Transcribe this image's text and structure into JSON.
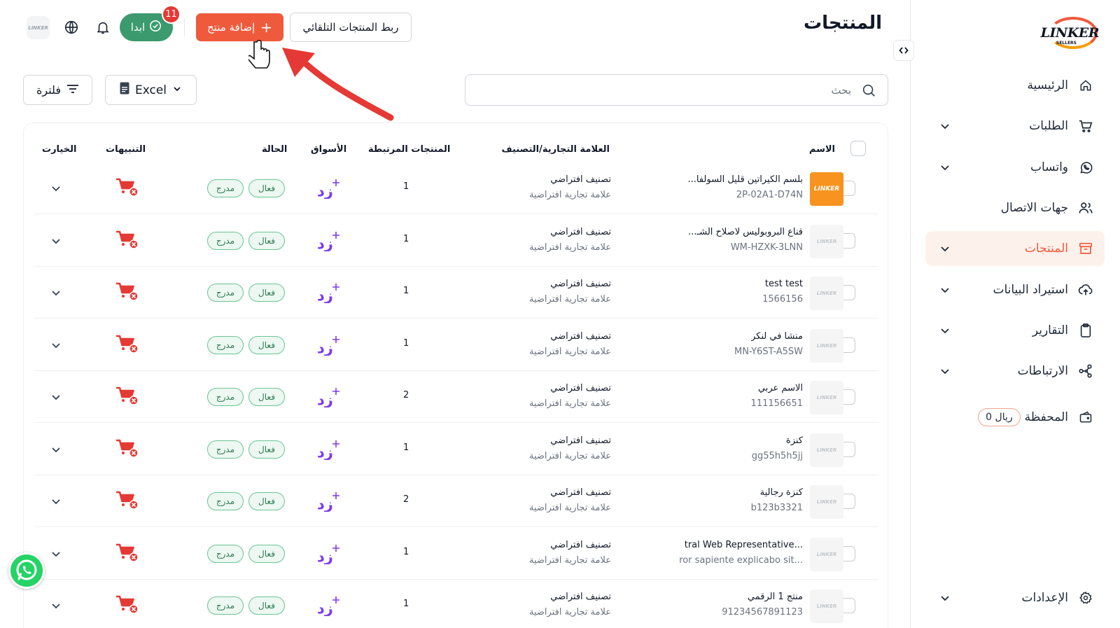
{
  "app": {
    "logo_text": "LINKER",
    "logo_sub": "SELLERS",
    "page_title": "المنتجات"
  },
  "sidebar": {
    "items": [
      {
        "label": "الرئيسية",
        "icon": "home-icon",
        "chevron": false,
        "active": false
      },
      {
        "label": "الطلبات",
        "icon": "cart-icon",
        "chevron": true,
        "active": false
      },
      {
        "label": "واتساب",
        "icon": "whatsapp-icon",
        "chevron": true,
        "active": false
      },
      {
        "label": "جهات الاتصال",
        "icon": "users-icon",
        "chevron": false,
        "active": false
      },
      {
        "label": "المنتجات",
        "icon": "box-icon",
        "chevron": true,
        "active": true
      },
      {
        "label": "استيراد البيانات",
        "icon": "upload-icon",
        "chevron": true,
        "active": false
      },
      {
        "label": "التقارير",
        "icon": "clipboard-icon",
        "chevron": true,
        "active": false
      },
      {
        "label": "الارتباطات",
        "icon": "share-icon",
        "chevron": true,
        "active": false
      }
    ],
    "wallet": {
      "label": "المحفظة",
      "balance": "0 ريال"
    },
    "settings": {
      "label": "الإعدادات"
    }
  },
  "toolbar": {
    "sync_label": "ربط المنتجات التلقائي",
    "add_label": "إضافة منتج",
    "start_label": "ابدا",
    "start_badge": "11",
    "avatar_text": "LINKER"
  },
  "search": {
    "placeholder": "بحث"
  },
  "filters": {
    "excel_label": "Excel",
    "filter_label": "فلترة"
  },
  "table": {
    "headers": {
      "name": "الاسم",
      "brand": "العلامة التجارية/التصنيف",
      "linked": "المنتجات المرتبطة",
      "markets": "الأسواق",
      "status": "الحالة",
      "alerts": "التنبيهات",
      "options": "الخيارت"
    },
    "status_active": "فعال",
    "status_listed": "مدرج",
    "market_logo": "زد",
    "rows": [
      {
        "name": "بلسم الكيراتين قليل السولفا...",
        "sku": "2P-02A1-D74N",
        "category": "تصنيف افتراضي",
        "brand": "علامة تجارية افتراضية",
        "linked": "1",
        "thumb": "orange"
      },
      {
        "name": "قناع البروبوليس لاصلاح الشـ...",
        "sku": "WM-HZXK-3LNN",
        "category": "تصنيف افتراضي",
        "brand": "علامة تجارية افتراضية",
        "linked": "1",
        "thumb": "gray"
      },
      {
        "name": "test test",
        "sku": "1566156",
        "category": "تصنيف افتراضي",
        "brand": "علامة تجارية افتراضية",
        "linked": "1",
        "thumb": "gray"
      },
      {
        "name": "منشأ في لنكر",
        "sku": "MN-Y6ST-A5SW",
        "category": "تصنيف افتراضي",
        "brand": "علامة تجارية افتراضية",
        "linked": "1",
        "thumb": "gray"
      },
      {
        "name": "الاسم عربي",
        "sku": "111156651",
        "category": "تصنيف افتراضي",
        "brand": "علامة تجارية افتراضية",
        "linked": "2",
        "thumb": "gray"
      },
      {
        "name": "كنزة",
        "sku": "gg55h5h5jj",
        "category": "تصنيف افتراضي",
        "brand": "علامة تجارية افتراضية",
        "linked": "1",
        "thumb": "gray"
      },
      {
        "name": "كنزة رجالية",
        "sku": "b123b3321",
        "category": "تصنيف افتراضي",
        "brand": "علامة تجارية افتراضية",
        "linked": "2",
        "thumb": "gray"
      },
      {
        "name": "...tral Web Representative",
        "sku": "...ror sapiente explicabo sit",
        "category": "تصنيف افتراضي",
        "brand": "علامة تجارية افتراضية",
        "linked": "1",
        "thumb": "gray"
      },
      {
        "name": "منتج 1 الرقمي",
        "sku": "91234567891123",
        "category": "تصنيف افتراضي",
        "brand": "علامة تجارية افتراضية",
        "linked": "1",
        "thumb": "gray"
      }
    ]
  },
  "colors": {
    "accent": "#ef5a3c",
    "start": "#3b9a6e",
    "badge": "#e53935",
    "market": "#7c3aed",
    "alert": "#e53935"
  }
}
